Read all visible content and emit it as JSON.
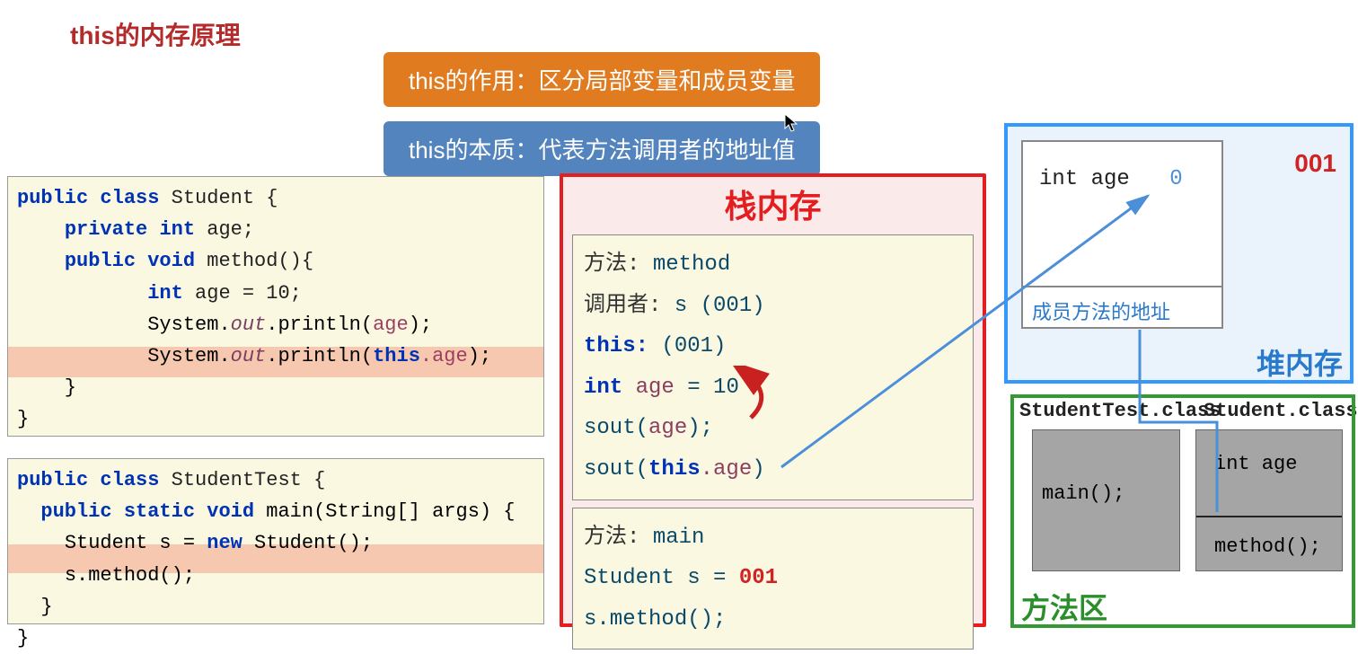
{
  "title": "this的内存原理",
  "banners": {
    "orange": "this的作用：区分局部变量和成员变量",
    "blue": "this的本质：代表方法调用者的地址值"
  },
  "code": {
    "student": {
      "line1_kw_public": "public",
      "line1_kw_class": "class",
      "line1_name": "Student {",
      "line2_kw_private": "private",
      "line2_kw_int": "int",
      "line2_name": "age;",
      "line3_kw_public": "public",
      "line3_kw_void": "void",
      "line3_method": "method(){",
      "line4_kw_int": "int",
      "line4_rest": "age = 10;",
      "line5_sys": "System.",
      "line5_out": "out",
      "line5_println": ".println(",
      "line5_arg": "age",
      "line5_close": ");",
      "line6_sys": "System.",
      "line6_out": "out",
      "line6_println": ".println(",
      "line6_this": "this",
      "line6_arg": ".age",
      "line6_close": ");",
      "line7": "    }",
      "line8": "}"
    },
    "studenttest": {
      "line1_kw_public": "public",
      "line1_kw_class": "class",
      "line1_name": "StudentTest {",
      "line2_kw_public": "public",
      "line2_kw_static": "static",
      "line2_kw_void": "void",
      "line2_main": "main(String[] args) {",
      "line3_pre": "Student s = ",
      "line3_new": "new",
      "line3_post": " Student();",
      "line4": "s.method();",
      "line5": "  }",
      "line6": "}"
    }
  },
  "stack": {
    "title": "栈内存",
    "frame_method": {
      "label1": "方法:",
      "val1": "method",
      "label2": "调用者:",
      "val2": "s (001)",
      "this_kw": "this:",
      "this_val": "(001)",
      "int_kw": "int",
      "age_var": "age",
      "age_assign": "= 10",
      "sout1": "sout(",
      "sout1_arg": "age",
      "sout1_close": ");",
      "sout2": "sout(",
      "sout2_this": "this",
      "sout2_age": ".age",
      "sout2_close": ")"
    },
    "frame_main": {
      "label1": "方法:",
      "val1": "main",
      "line2_pre": "Student s = ",
      "line2_val": "001",
      "line3": "s.method();"
    }
  },
  "heap": {
    "title": "堆内存",
    "address": "001",
    "field_name": "int age",
    "field_value": "0",
    "method_addr": "成员方法的地址"
  },
  "method_area": {
    "title": "方法区",
    "class_test_label": "StudentTest.class",
    "class_test_method": "main();",
    "class_student_label": "Student.class",
    "class_student_field": "int age",
    "class_student_method": "method();"
  }
}
